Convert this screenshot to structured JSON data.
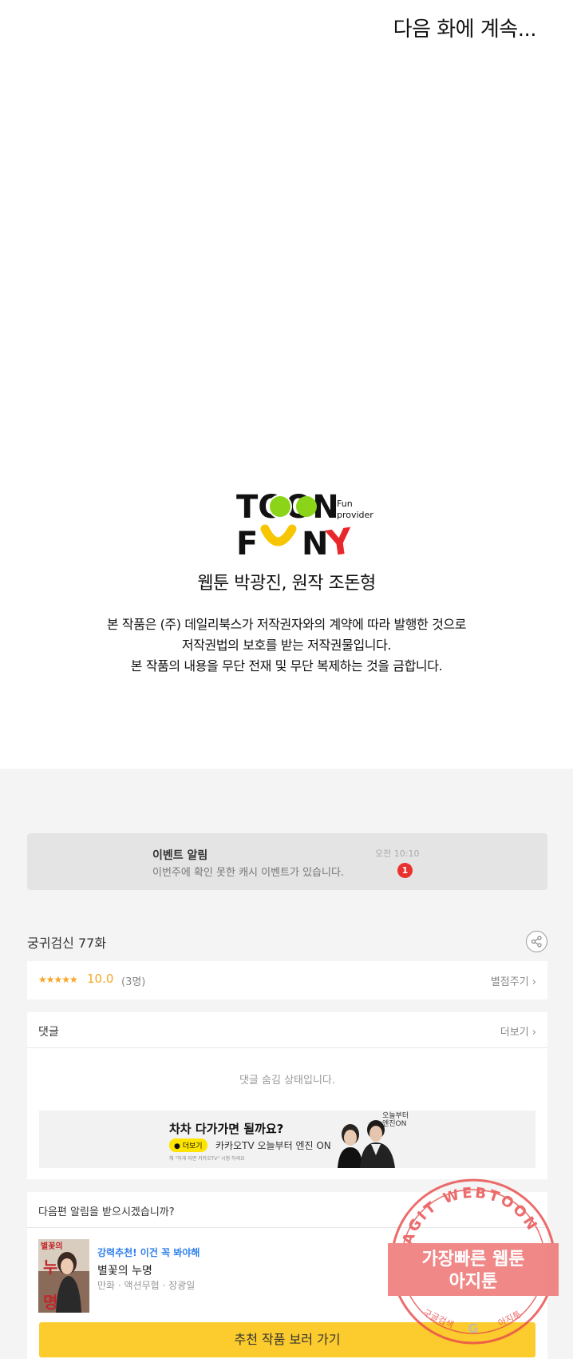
{
  "continue_text": "다음 화에 계속...",
  "logo": {
    "line1": "TOON",
    "line2_parts": [
      "F",
      "N",
      "Y"
    ],
    "tagline_1": "Fun",
    "tagline_2": "provider"
  },
  "credit_line": "웹툰  박광진, 원작 조돈형",
  "notice_lines": [
    "본 작품은 (주) 데일리북스가 저작권자와의 계약에 따라 발행한 것으로",
    "저작권법의 보호를 받는 저작권물입니다.",
    "본 작품의 내용을 무단 전재 및 무단 복제하는 것을 금합니다."
  ],
  "event": {
    "title": "이벤트 알림",
    "desc": "이번주에 확인 못한 캐시 이벤트가 있습니다.",
    "time": "오전 10:10",
    "badge": "1"
  },
  "episode": {
    "title": "궁귀검신 77화",
    "share_icon": "share-icon"
  },
  "rating": {
    "stars": "★★★★★",
    "score": "10.0",
    "count": "(3명)",
    "rate_link": "별점주기 ›"
  },
  "comments": {
    "title": "댓글",
    "more": "더보기 ›",
    "hidden_msg": "댓글 숨김 상태입니다."
  },
  "ad": {
    "title": "차차 다가가면 될까요?",
    "button": "● 더보기",
    "desc": "카카오TV 오늘부터 엔진 ON",
    "fine": "해 \"하게 되면 카카오TV\" 시청 하세요",
    "logo_1": "오늘부터",
    "logo_2": "엔진ON"
  },
  "next": {
    "title": "다음편 알림을 받으시겠습니까?",
    "tag": "강력추천! 이건 꼭 봐야해",
    "name": "별꽃의 누명",
    "meta": "만화 · 액션무협 · 장광일",
    "cover_text_1": "별꽃의",
    "cover_text_2": "누",
    "cover_text_3": "명",
    "button": "추천 작품 보러 가기"
  },
  "watermark": {
    "top_arc": "AGIT WEBTOON",
    "line1": "가장빠른 웹툰",
    "line2": "아지툰",
    "bottom_left": "구글검색",
    "bottom_right": "아지툰",
    "center_letter": "G"
  },
  "colors": {
    "yellow_button": "#fccb2d",
    "badge_red": "#e8322f",
    "star_orange": "#f6a623",
    "watermark_red": "#e94b4b"
  }
}
